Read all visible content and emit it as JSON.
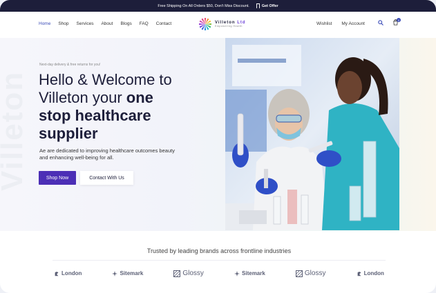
{
  "topbar": {
    "shipping_text": "Free Shipping On All Orders $50, Don't Miss Discount.",
    "offer_label": "Get Offer"
  },
  "nav": {
    "items": [
      "Home",
      "Shop",
      "Services",
      "About",
      "Blogs",
      "FAQ",
      "Contact"
    ],
    "active": "Home"
  },
  "logo": {
    "name_main": "Villeton",
    "name_suffix": "Ltd",
    "tagline": "Empowering Health"
  },
  "account": {
    "wishlist": "Wishlist",
    "my_account": "My Account",
    "cart_count": "0"
  },
  "hero": {
    "watermark": "Villeton",
    "eyebrow": "Next-day delivery & free returns for you!",
    "headline_line1": "Hello & Welcome to",
    "headline_line2_plain": "Villeton your ",
    "headline_line2_bold": "one",
    "headline_line3": "stop healthcare",
    "headline_line4": "supplier",
    "subtext": "Ae are dedicated to improving healthcare outcomes beauty and enhancing well-being for all.",
    "shop_button": "Shop Now",
    "contact_button": "Contact With Us"
  },
  "trusted": {
    "title": "Trusted by leading brands across frontline industries",
    "brands": [
      {
        "name": "London",
        "icon": "london-icon"
      },
      {
        "name": "Sitemark",
        "icon": "sitemark-icon"
      },
      {
        "name": "Glossy",
        "icon": "glossy-icon"
      },
      {
        "name": "Sitemark",
        "icon": "sitemark-icon"
      },
      {
        "name": "Glossy",
        "icon": "glossy-icon"
      },
      {
        "name": "London",
        "icon": "london-icon"
      }
    ]
  },
  "colors": {
    "topbar_bg": "#1d1e3a",
    "primary": "#4c2fb6",
    "nav_active": "#3b4cb8",
    "heading": "#1d1e3a"
  }
}
